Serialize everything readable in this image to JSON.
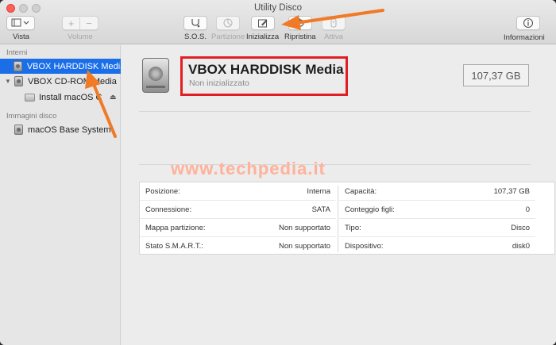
{
  "window": {
    "title": "Utility Disco"
  },
  "toolbar": {
    "vista": "Vista",
    "volume": "Volume",
    "sos": "S.O.S.",
    "partizione": "Partizione",
    "inizializza": "Inizializza",
    "ripristina": "Ripristina",
    "attiva": "Attiva",
    "informazioni": "Informazioni"
  },
  "sidebar": {
    "section_internal": "Interni",
    "section_images": "Immagini disco",
    "items": [
      {
        "label": "VBOX HARDDISK Media",
        "selected": true
      },
      {
        "label": "VBOX CD-ROM Media"
      },
      {
        "label": "Install macOS C"
      },
      {
        "label": "macOS Base System"
      }
    ]
  },
  "disk": {
    "name": "VBOX HARDDISK Media",
    "status": "Non inizializzato",
    "size": "107,37 GB"
  },
  "watermark": "www.techpedia.it",
  "info": {
    "left": [
      {
        "label": "Posizione:",
        "value": "Interna"
      },
      {
        "label": "Connessione:",
        "value": "SATA"
      },
      {
        "label": "Mappa partizione:",
        "value": "Non supportato"
      },
      {
        "label": "Stato S.M.A.R.T.:",
        "value": "Non supportato"
      }
    ],
    "right": [
      {
        "label": "Capacità:",
        "value": "107,37 GB"
      },
      {
        "label": "Conteggio figli:",
        "value": "0"
      },
      {
        "label": "Tipo:",
        "value": "Disco"
      },
      {
        "label": "Dispositivo:",
        "value": "disk0"
      }
    ]
  },
  "colors": {
    "selection": "#1a6ee8",
    "highlight_box": "#e11e24",
    "arrow": "#f07a25"
  }
}
